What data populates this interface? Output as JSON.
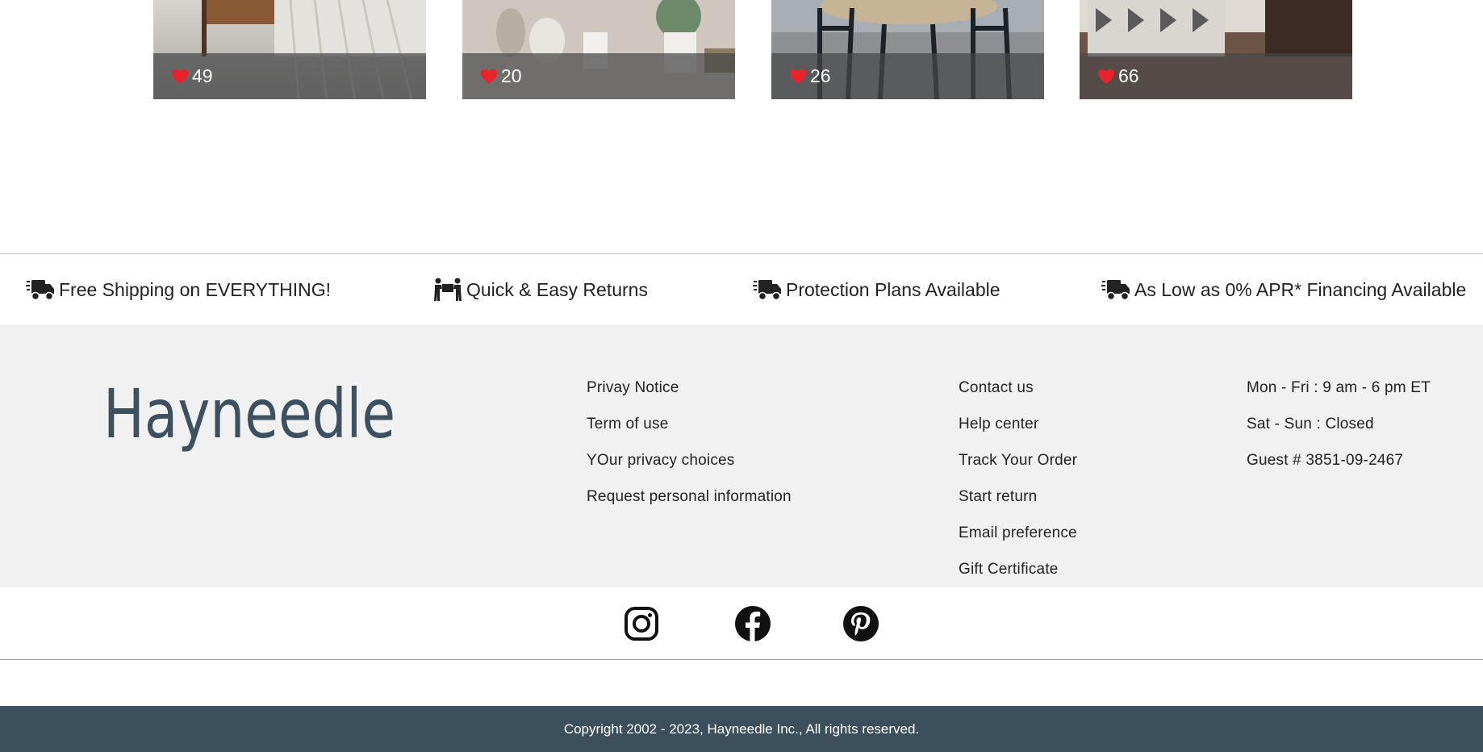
{
  "gallery": {
    "cards": [
      {
        "likes": "49"
      },
      {
        "likes": "20"
      },
      {
        "likes": "26"
      },
      {
        "likes": "66"
      }
    ],
    "heart_color": "#e8232b"
  },
  "features": [
    {
      "icon": "delivery-truck-icon",
      "label": "Free Shipping on EVERYTHING!"
    },
    {
      "icon": "movers-icon",
      "label": "Quick & Easy Returns"
    },
    {
      "icon": "delivery-truck-icon",
      "label": "Protection Plans Available"
    },
    {
      "icon": "delivery-truck-icon",
      "label": "As Low as 0% APR* Financing Available"
    }
  ],
  "footer": {
    "logo_text": "Hayneedle",
    "logo_color": "#3d5060",
    "legal_links": [
      "Privay Notice",
      "Term of use",
      "YOur privacy choices",
      "Request personal information"
    ],
    "help_links": [
      "Contact us",
      "Help center",
      "Track Your Order",
      "Start return",
      "Email preference",
      "Gift Certificate"
    ],
    "hours": [
      "Mon - Fri : 9 am - 6 pm ET",
      "Sat - Sun : Closed",
      "Guest # 3851-09-2467"
    ]
  },
  "social": [
    "instagram-icon",
    "facebook-icon",
    "pinterest-icon"
  ],
  "copyright": "Copyright 2002 - 2023, Hayneedle Inc., All rights reserved.",
  "colors": {
    "footer_bg": "#f1f1f1",
    "copyright_bg": "#3c4f5c",
    "text": "#222222"
  }
}
